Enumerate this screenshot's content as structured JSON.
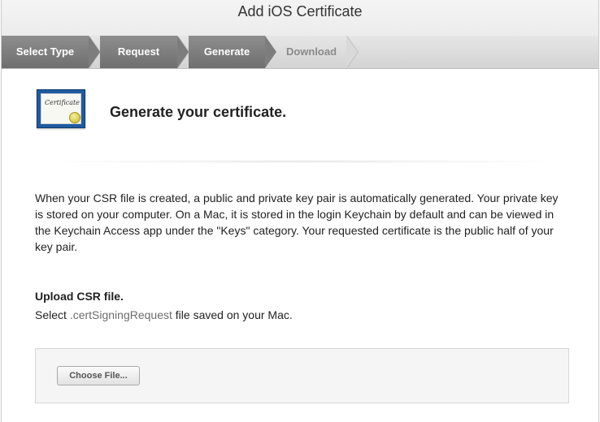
{
  "window": {
    "title": "Add iOS Certificate"
  },
  "steps": [
    {
      "label": "Select Type",
      "state": "done"
    },
    {
      "label": "Request",
      "state": "done"
    },
    {
      "label": "Generate",
      "state": "done"
    },
    {
      "label": "Download",
      "state": "upcoming"
    }
  ],
  "header": {
    "icon_text": "Certificate",
    "icon_name": "certificate-icon",
    "headline": "Generate your certificate."
  },
  "body": {
    "paragraph": "When your CSR file is created, a public and private key pair is automatically generated. Your private key is stored on your computer. On a Mac, it is stored in the login Keychain by default and can be viewed in the Keychain Access app under the \"Keys\" category. Your requested certificate is the public half of your key pair."
  },
  "upload": {
    "title": "Upload CSR file.",
    "desc_prefix": "Select ",
    "desc_ext": ".certSigningRequest",
    "desc_suffix": " file saved on your Mac.",
    "button_label": "Choose File..."
  },
  "colors": {
    "step_done": "#7d7d7d",
    "step_upcoming": "#8a8a8a",
    "icon_blue": "#1e5aa0"
  }
}
